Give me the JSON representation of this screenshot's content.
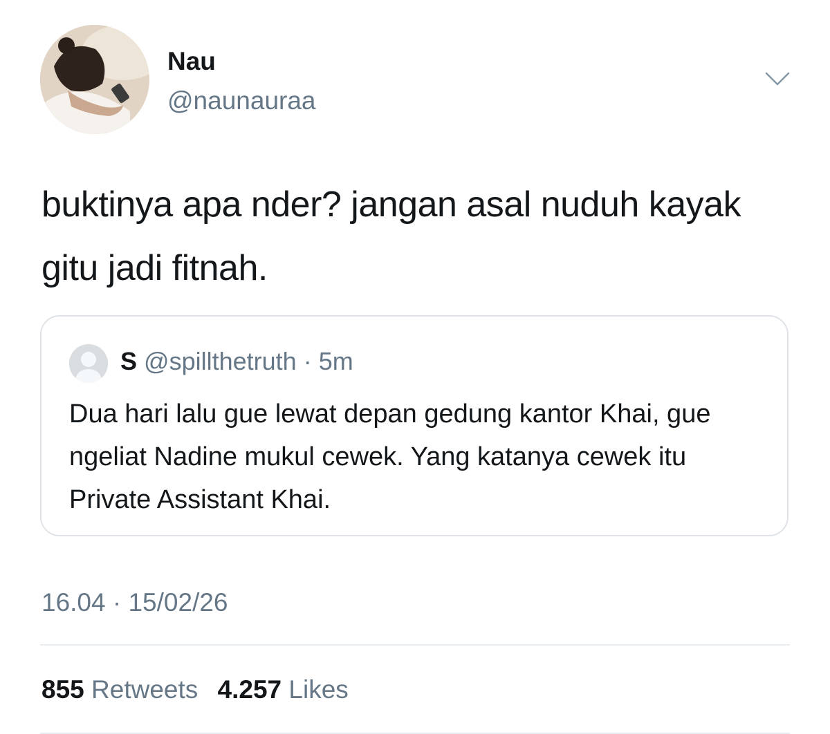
{
  "author": {
    "display_name": "Nau",
    "handle": "@naunauraa",
    "avatar_icon": "profile-photo"
  },
  "menu": {
    "icon": "chevron-down-icon"
  },
  "tweet": {
    "text": "buktinya apa nder? jangan asal nuduh kayak gitu jadi fitnah."
  },
  "quoted_tweet": {
    "display_name": "S",
    "handle": "@spillthetruth",
    "separator": "·",
    "time_ago": "5m",
    "text": "Dua hari lalu gue lewat depan gedung kantor Khai, gue ngeliat Nadine mukul cewek. Yang katanya cewek itu Private Assistant Khai.",
    "avatar_icon": "default-avatar-icon"
  },
  "timestamp": {
    "time": "16.04",
    "separator": "·",
    "date": "15/02/26"
  },
  "stats": {
    "retweets_count": "855",
    "retweets_label": "Retweets",
    "likes_count": "4.257",
    "likes_label": "Likes"
  },
  "colors": {
    "primary_text": "#14171a",
    "secondary_text": "#657786",
    "border": "#dfe3e7"
  }
}
